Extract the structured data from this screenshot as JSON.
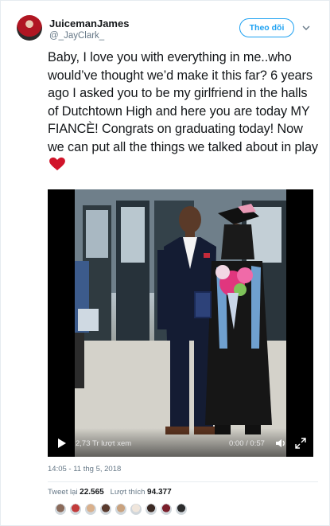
{
  "user": {
    "display_name": "JuicemanJames",
    "handle": "@_JayClark_",
    "follow_label": "Theo dõi"
  },
  "tweet": {
    "text": "Baby, I love you with everything in me..who would’ve thought we’d make it this far? 6 years ago I asked you to be my girlfriend in the halls of Dutchtown High and here you are today MY FIANCÈ! Congrats on graduating today! Now we can put all the things we talked about in play"
  },
  "video": {
    "views": "2,73 Tr lượt xem",
    "time": "0:00 / 0:57"
  },
  "meta": {
    "timestamp": "14:05 - 11 thg 5, 2018",
    "retweets_label": "Tweet lại",
    "retweets_count": "22.565",
    "likes_label": "Lượt thích",
    "likes_count": "94.377"
  },
  "colors": {
    "accent": "#1da1f2",
    "heart": "#e0245e",
    "text": "#14171a",
    "muted": "#657786"
  },
  "liker_avatars": [
    "#8a6a5a",
    "#c23b3b",
    "#d9b08c",
    "#5a3b2e",
    "#c9a27e",
    "#f0e6dc",
    "#3b2a24",
    "#7a1f2b",
    "#2c2c2c"
  ]
}
